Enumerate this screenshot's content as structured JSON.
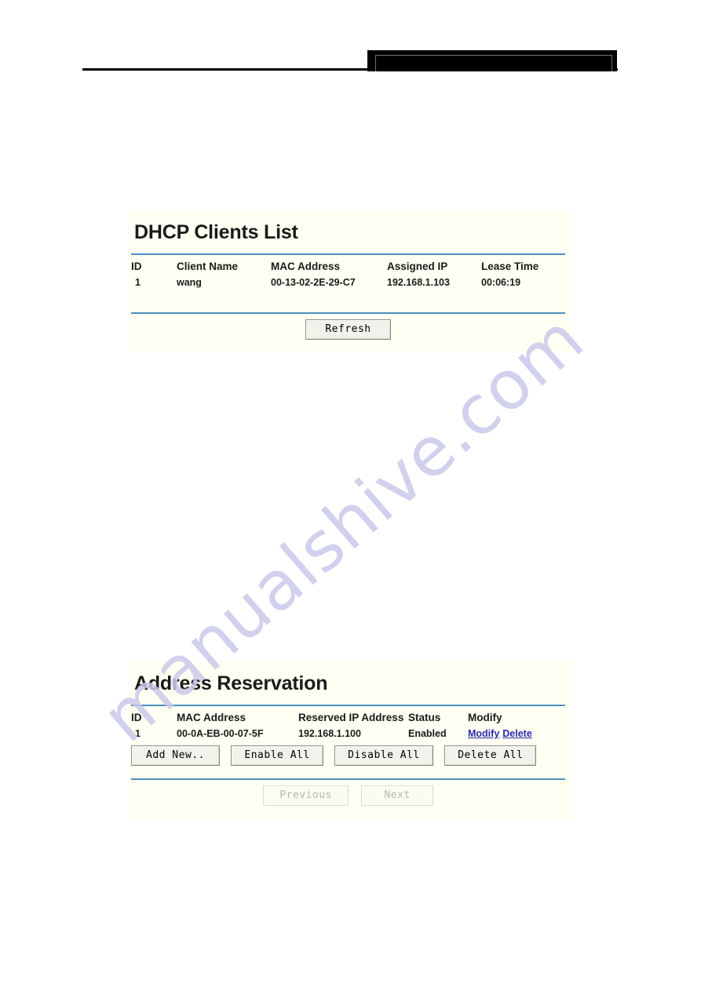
{
  "header": {
    "redaction_label": "redacted-black-bar"
  },
  "watermark": {
    "text": "manualshive.com",
    "color": "#c9c9ea"
  },
  "theme": {
    "panel_background": "#fffff3",
    "divider_color": "#4a90c0",
    "link_color": "#2a2ab0",
    "text_color": "#1a1a1a"
  },
  "dhcp_clients": {
    "title": "DHCP Clients List",
    "columns": [
      "ID",
      "Client Name",
      "MAC Address",
      "Assigned IP",
      "Lease Time"
    ],
    "rows": [
      {
        "id": "1",
        "client_name": "wang",
        "mac_address": "00-13-02-2E-29-C7",
        "assigned_ip": "192.168.1.103",
        "lease_time": "00:06:19"
      }
    ],
    "refresh_label": "Refresh"
  },
  "address_reservation": {
    "title": "Address Reservation",
    "columns": [
      "ID",
      "MAC Address",
      "Reserved IP Address",
      "Status",
      "Modify"
    ],
    "rows": [
      {
        "id": "1",
        "mac_address": "00-0A-EB-00-07-5F",
        "reserved_ip": "192.168.1.100",
        "status": "Enabled",
        "modify_link": "Modify",
        "delete_link": "Delete"
      }
    ],
    "buttons": {
      "add_new": "Add New..",
      "enable_all": "Enable All",
      "disable_all": "Disable All",
      "delete_all": "Delete All"
    },
    "pagination": {
      "previous": "Previous",
      "next": "Next"
    }
  }
}
